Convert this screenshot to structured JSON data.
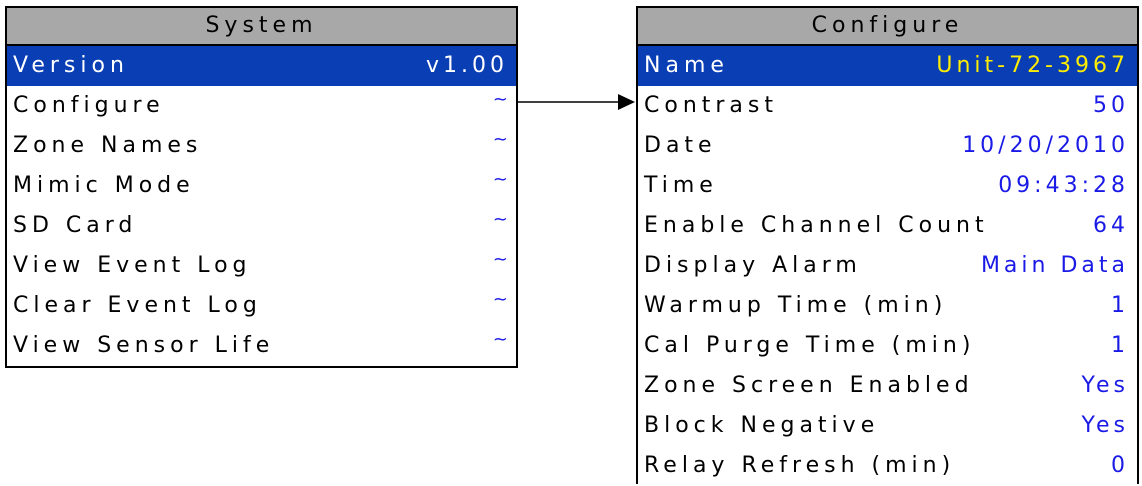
{
  "system": {
    "title": "System",
    "items": [
      {
        "label": "Version",
        "value": "v1.00"
      },
      {
        "label": "Configure",
        "value": "~"
      },
      {
        "label": "Zone Names",
        "value": "~"
      },
      {
        "label": "Mimic Mode",
        "value": "~"
      },
      {
        "label": "SD Card",
        "value": "~"
      },
      {
        "label": "View Event Log",
        "value": "~"
      },
      {
        "label": "Clear Event Log",
        "value": "~"
      },
      {
        "label": "View Sensor Life",
        "value": "~"
      }
    ]
  },
  "configure": {
    "title": "Configure",
    "items": [
      {
        "label": "Name",
        "value": "Unit-72-3967"
      },
      {
        "label": "Contrast",
        "value": "50"
      },
      {
        "label": "Date",
        "value": "10/20/2010"
      },
      {
        "label": "Time",
        "value": "09:43:28"
      },
      {
        "label": "Enable Channel Count",
        "value": "64"
      },
      {
        "label": "Display Alarm",
        "value": "Main Data"
      },
      {
        "label": "Warmup Time (min)",
        "value": "1"
      },
      {
        "label": "Cal Purge Time (min)",
        "value": "1"
      },
      {
        "label": "Zone Screen Enabled",
        "value": "Yes"
      },
      {
        "label": "Block Negative",
        "value": "Yes"
      },
      {
        "label": "Relay Refresh (min)",
        "value": "0"
      }
    ]
  },
  "colors": {
    "title_bar": "#a8a8a8",
    "selected_bg": "#0a3eb4",
    "value_text": "#1a1ae6",
    "selected_name_value": "#ffee00"
  }
}
